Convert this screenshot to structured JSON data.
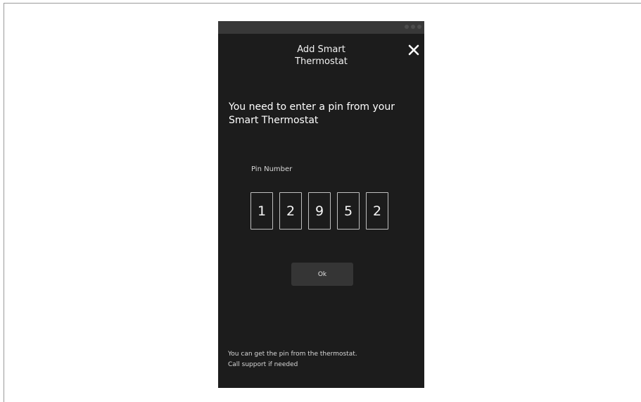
{
  "screen": {
    "title": "Add Smart\nThermostat",
    "close_icon": "close-icon"
  },
  "main": {
    "prompt": "You need to enter a pin from your Smart Thermostat",
    "pin_label": "Pin Number",
    "pin_digits": [
      "1",
      "2",
      "9",
      "5",
      "2"
    ],
    "ok_label": "Ok"
  },
  "footer": {
    "note": "You can get the pin from the thermostat.\nCall support if needed"
  }
}
